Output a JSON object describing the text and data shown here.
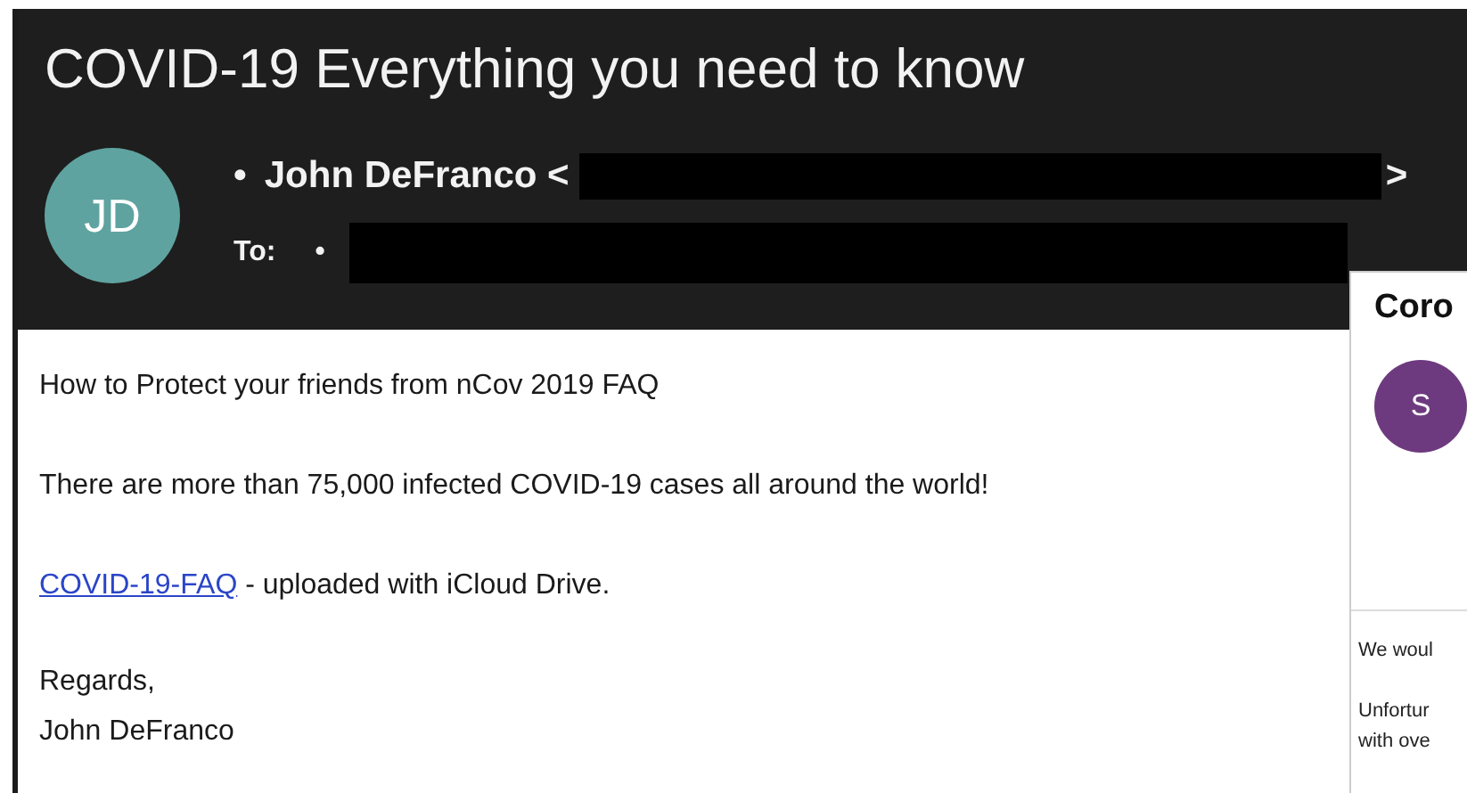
{
  "email": {
    "subject": "COVID-19 Everything you need to know",
    "avatar": "JD",
    "sender_bullet": "•",
    "sender": "John DeFranco <",
    "sender_end": ">",
    "to_label": "To:",
    "to_bullet": "•",
    "body": {
      "intro": "How to Protect your friends from nCov 2019 FAQ",
      "claim": "There are more than 75,000 infected COVID-19 cases all around the world!",
      "link": "COVID-19-FAQ",
      "link_suffix": " - uploaded with iCloud Drive.",
      "closing": "Regards,",
      "signature": "John DeFranco"
    }
  },
  "second_email": {
    "subject": "Coro",
    "avatar": "S",
    "lines": [
      "We woul",
      "Unfortur",
      "with ove"
    ]
  }
}
